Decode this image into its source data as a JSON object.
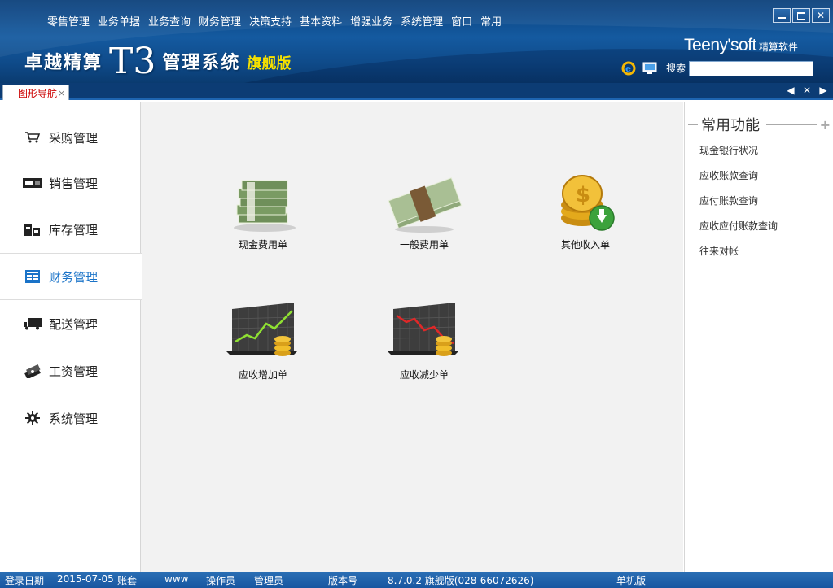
{
  "menu": [
    "零售管理",
    "业务单据",
    "业务查询",
    "财务管理",
    "决策支持",
    "基本资料",
    "增强业务",
    "系统管理",
    "窗口",
    "常用"
  ],
  "brand": {
    "name": "卓越精算",
    "t3": "T3",
    "system": "管理系统",
    "edition": "旗舰版"
  },
  "company": {
    "logo_text": "Teeny'soft",
    "logo_cn": "精算软件"
  },
  "search": {
    "label": "搜索",
    "value": ""
  },
  "tab": {
    "label": "图形导航",
    "close": "×"
  },
  "tab_controls": {
    "prev": "◀",
    "close": "✕",
    "next": "▶"
  },
  "sidebar": {
    "items": [
      {
        "label": "采购管理",
        "icon": "cart-icon"
      },
      {
        "label": "销售管理",
        "icon": "cash-register-icon"
      },
      {
        "label": "库存管理",
        "icon": "warehouse-icon"
      },
      {
        "label": "财务管理",
        "icon": "ledger-icon",
        "active": true
      },
      {
        "label": "配送管理",
        "icon": "truck-icon"
      },
      {
        "label": "工资管理",
        "icon": "money-stack-icon"
      },
      {
        "label": "系统管理",
        "icon": "gear-icon"
      }
    ]
  },
  "tiles": [
    {
      "label": "现金费用单",
      "icon": "cash-stack-icon"
    },
    {
      "label": "一般费用单",
      "icon": "banknote-bundle-icon"
    },
    {
      "label": "其他收入单",
      "icon": "coins-download-icon"
    },
    {
      "label": "应收增加单",
      "icon": "chart-up-icon"
    },
    {
      "label": "应收减少单",
      "icon": "chart-down-icon"
    }
  ],
  "right_panel": {
    "title": "常用功能",
    "links": [
      "现金银行状况",
      "应收账款查询",
      "应付账款查询",
      "应收应付账款查询",
      "往来对帐"
    ]
  },
  "status": {
    "login_date_label": "登录日期",
    "login_date": "2015-07-05",
    "account_label": "账套",
    "account": "www",
    "operator_label": "操作员",
    "operator": "管理员",
    "version_label": "版本号",
    "version": "8.7.0.2 旗舰版(028-66072626)",
    "mode": "单机版"
  },
  "colors": {
    "header": "#145aa0",
    "active": "#1a73c8",
    "edition": "#f6e100",
    "statusbar": "#1856a0"
  }
}
